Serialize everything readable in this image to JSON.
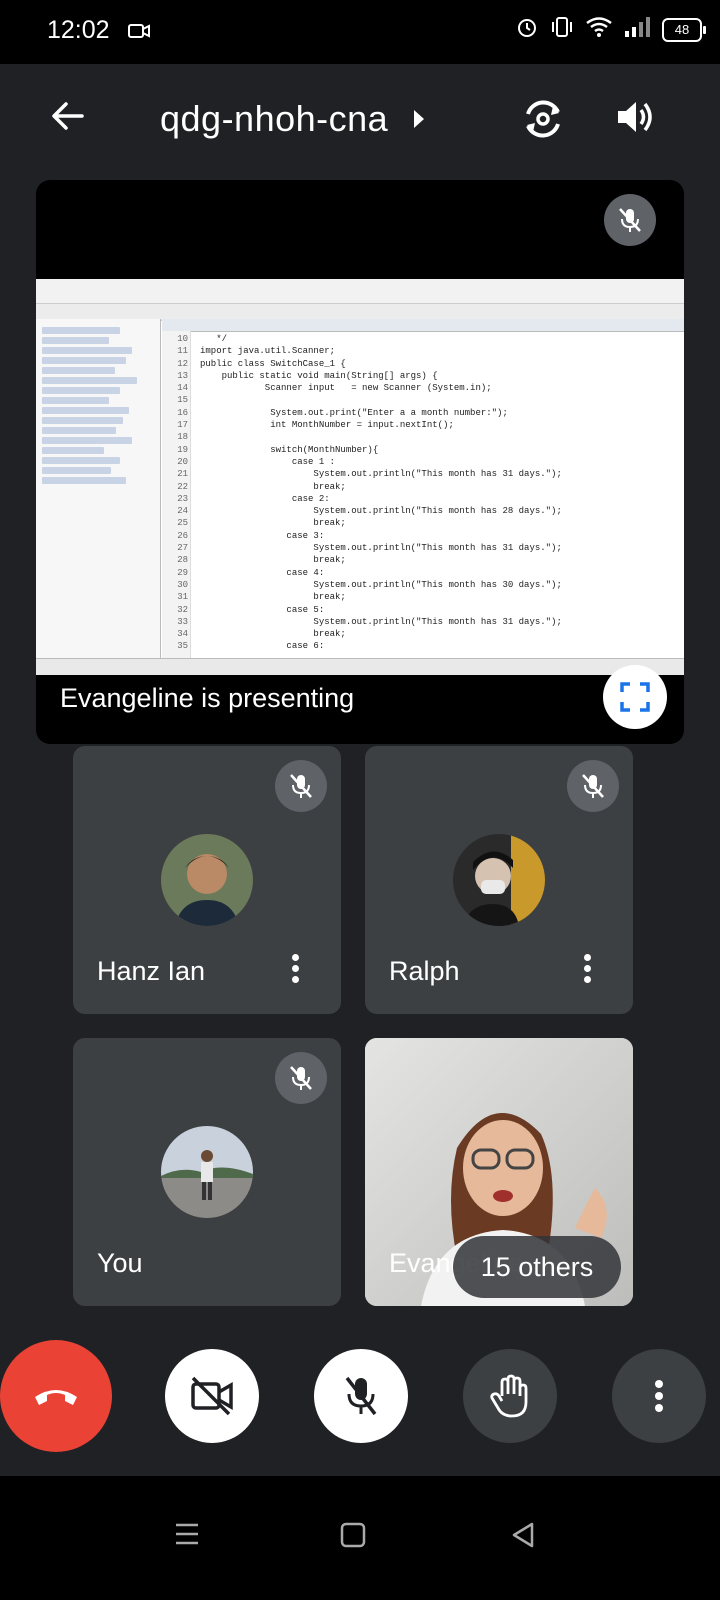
{
  "status_bar": {
    "time": "12:02",
    "battery": "48",
    "icons": [
      "video-record-icon",
      "alarm-icon",
      "vibrate-icon",
      "wifi-icon",
      "signal-icon",
      "battery-icon"
    ]
  },
  "header": {
    "meeting_code": "qdg-nhoh-cna",
    "back_icon": "arrow-back-icon",
    "switch_camera_icon": "switch-camera-icon",
    "speaker_icon": "speaker-icon"
  },
  "presentation": {
    "label": "Evangeline is presenting",
    "ide": {
      "line_numbers": [
        "10",
        "11",
        "12",
        "13",
        "14",
        "15",
        "16",
        "17",
        "18",
        "19",
        "20",
        "21",
        "22",
        "23",
        "24",
        "25",
        "26",
        "27",
        "28",
        "29",
        "30",
        "31",
        "32",
        "33",
        "34",
        "35"
      ],
      "lines": [
        "   */",
        "import java.util.Scanner;",
        "public class SwitchCase_1 {",
        "    public static void main(String[] args) {",
        "            Scanner input   = new Scanner (System.in);",
        "",
        "             System.out.print(\"Enter a a month number:\");",
        "             int MonthNumber = input.nextInt();",
        "",
        "             switch(MonthNumber){",
        "                 case 1 :",
        "                     System.out.println(\"This month has 31 days.\");",
        "                     break;",
        "                 case 2:",
        "                     System.out.println(\"This month has 28 days.\");",
        "                     break;",
        "                case 3:",
        "                     System.out.println(\"This month has 31 days.\");",
        "                     break;",
        "                case 4:",
        "                     System.out.println(\"This month has 30 days.\");",
        "                     break;",
        "                case 5:",
        "                     System.out.println(\"This month has 31 days.\");",
        "                     break;",
        "                case 6:"
      ]
    }
  },
  "participants": [
    {
      "name": "Hanz Ian",
      "muted": true
    },
    {
      "name": "Ralph",
      "muted": true
    },
    {
      "name": "You",
      "muted": true
    },
    {
      "name": "Evangeline",
      "others_label": "15 others"
    }
  ],
  "controls": [
    "end-call-icon",
    "camera-off-icon",
    "mic-off-icon",
    "raise-hand-icon",
    "more-options-icon"
  ],
  "colors": {
    "end_call": "#ea4335",
    "tile_bg": "#3c4043",
    "background": "#202124"
  }
}
